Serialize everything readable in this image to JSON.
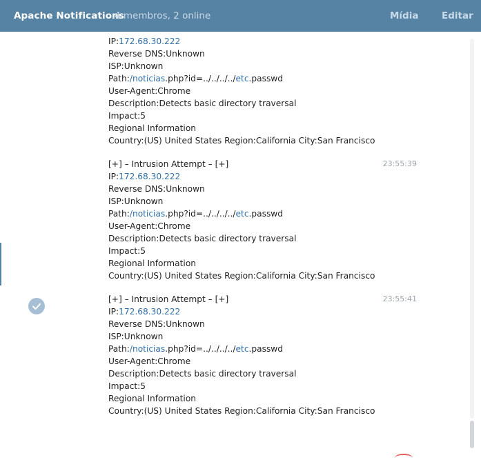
{
  "header": {
    "title": "Apache Notifications",
    "subtitle": "4 membros, 2 online",
    "media_label": "Mídia",
    "edit_label": "Editar"
  },
  "messages": [
    {
      "time": "",
      "header": "",
      "ip_label": "IP:",
      "ip_value": "172.68.30.222",
      "reverse_dns": "Reverse DNS:Unknown",
      "isp": "ISP:Unknown",
      "path_label": "Path:",
      "path_link1": "/noticias",
      "path_mid": ".php?id=../../../../",
      "path_link2": "etc",
      "path_end": ".passwd",
      "user_agent": "User-Agent:Chrome",
      "description": "Description:Detects basic directory traversal",
      "impact": "Impact:5",
      "regional": "Regional Information",
      "country": "Country:(US) United States Region:California City:San Francisco"
    },
    {
      "time": "23:55:39",
      "header": "[+] – Intrusion Attempt – [+]",
      "ip_label": "IP:",
      "ip_value": "172.68.30.222",
      "reverse_dns": "Reverse DNS:Unknown",
      "isp": "ISP:Unknown",
      "path_label": "Path:",
      "path_link1": "/noticias",
      "path_mid": ".php?id=../../../../",
      "path_link2": "etc",
      "path_end": ".passwd",
      "user_agent": "User-Agent:Chrome",
      "description": "Description:Detects basic directory traversal",
      "impact": "Impact:5",
      "regional": "Regional Information",
      "country": "Country:(US) United States Region:California City:San Francisco"
    },
    {
      "time": "23:55:41",
      "header": "[+] – Intrusion Attempt – [+]",
      "ip_label": "IP:",
      "ip_value": "172.68.30.222",
      "reverse_dns": "Reverse DNS:Unknown",
      "isp": "ISP:Unknown",
      "path_label": "Path:",
      "path_link1": "/noticias",
      "path_mid": ".php?id=../../../../",
      "path_link2": "etc",
      "path_end": ".passwd",
      "user_agent": "User-Agent:Chrome",
      "description": "Description:Detects basic directory traversal",
      "impact": "Impact:5",
      "regional": "Regional Information",
      "country": "Country:(US) United States Region:California City:San Francisco"
    }
  ],
  "colors": {
    "header_bg": "#5682a3",
    "link": "#2f6ea5",
    "check_bg": "#a7bfd4"
  },
  "icons": {
    "selected_message": "check-circle-icon"
  }
}
